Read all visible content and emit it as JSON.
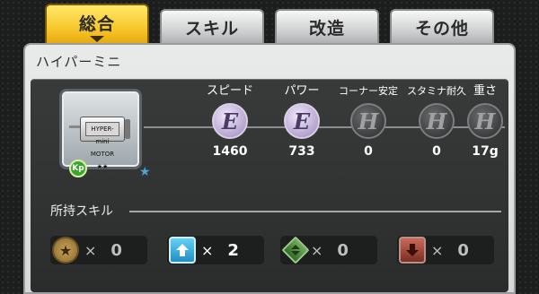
{
  "tabs": [
    {
      "label": "総合",
      "active": true
    },
    {
      "label": "スキル",
      "active": false
    },
    {
      "label": "改造",
      "active": false
    },
    {
      "label": "その他",
      "active": false
    }
  ],
  "part": {
    "name": "ハイパーミニ",
    "badge": "Kp",
    "motor_label": "HYPER-mini MOTOR ★★"
  },
  "stats": [
    {
      "name": "スピード",
      "grade": "E",
      "value": "1460"
    },
    {
      "name": "パワー",
      "grade": "E",
      "value": "733"
    },
    {
      "name": "コーナー安定",
      "grade": "H",
      "value": "0"
    },
    {
      "name": "スタミナ耐久",
      "grade": "H",
      "value": "0"
    },
    {
      "name": "重さ",
      "grade": "H",
      "value": "17g"
    }
  ],
  "skills": {
    "heading": "所持スキル",
    "items": [
      {
        "icon": "star-circle-icon",
        "times": "×",
        "count": "0"
      },
      {
        "icon": "up-arrow-icon",
        "times": "×",
        "count": "2"
      },
      {
        "icon": "diamond-arrows-icon",
        "times": "×",
        "count": "0"
      },
      {
        "icon": "down-arrow-icon",
        "times": "×",
        "count": "0"
      }
    ]
  },
  "colors": {
    "active_tab": "#f7c62a",
    "grade_e": "#b6a4cf",
    "grade_h": "#3c3e40"
  }
}
